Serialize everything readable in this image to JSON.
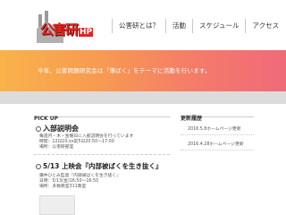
{
  "header": {
    "logo_text": "公害研",
    "logo_hp": "HP"
  },
  "nav": {
    "items": [
      {
        "label": "公害研とは？"
      },
      {
        "label": "活動"
      },
      {
        "label": "スケジュール"
      },
      {
        "label": "アクセス"
      }
    ]
  },
  "banner": {
    "text": "今年、公害問題研究会は「薄ばく」をテーマに活動を行います。"
  },
  "pickup": {
    "heading": "PICK UP",
    "items": [
      {
        "title": "入部説明会",
        "lines": [
          "毎週月・木・金曜日に入部説明会を行っています",
          "時間：12日10:xx前5日20:50〜17:00",
          "場所：公害研部室"
        ]
      },
      {
        "title": "5/13 上映会『内部被ばくを生き抜く』",
        "lines": [
          "鎌仲ひとみ監督『内部被ばくを生き抜く』",
          "日時：5/13(金)16:50〜16:50",
          "場所：多数教室311教室"
        ]
      }
    ]
  },
  "updates": {
    "heading": "更新履歴",
    "items": [
      {
        "text": "2016.5.8ホームページ更新"
      },
      {
        "text": "2016.4.28ホームページ更新"
      }
    ]
  }
}
